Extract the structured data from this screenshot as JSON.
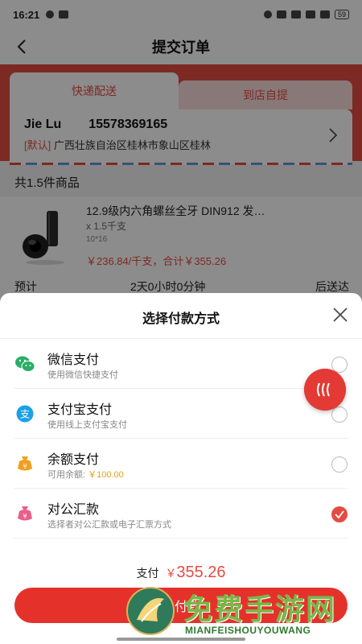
{
  "status_bar": {
    "time": "16:21",
    "battery": "59"
  },
  "nav": {
    "title": "提交订单"
  },
  "delivery": {
    "tab_express": "快递配送",
    "tab_pickup": "到店自提",
    "name": "Jie Lu",
    "phone": "15578369165",
    "default_tag": "[默认]",
    "address": "广西壮族自治区桂林市象山区桂林"
  },
  "goods": {
    "count_label": "共1.5件商品",
    "title": "12.9级内六角螺丝全牙 DIN912 发…",
    "qty": "x 1.5千支",
    "spec": "10*16",
    "price_line": "￥236.84/千支，合计￥355.26"
  },
  "eta": {
    "label": "预计",
    "value": "2天0小时0分钟",
    "suffix": "后送达"
  },
  "payment_sheet": {
    "title": "选择付款方式",
    "options": [
      {
        "name": "微信支付",
        "desc": "使用微信快捷支付",
        "icon": "wechat-icon",
        "selected": false
      },
      {
        "name": "支付宝支付",
        "desc": "使用线上支付宝支付",
        "icon": "alipay-icon",
        "selected": false
      },
      {
        "name": "余额支付",
        "desc_prefix": "可用余额:",
        "desc_amount": "￥100.00",
        "icon": "wallet-icon",
        "selected": false
      },
      {
        "name": "对公汇款",
        "desc": "选择者对公汇款或电子汇票方式",
        "icon": "bank-transfer-icon",
        "selected": true
      }
    ],
    "total_label": "支付",
    "currency": "￥",
    "total_amount": "355.26",
    "pay_button": "去付款"
  },
  "watermark": {
    "title": "免费手游网",
    "subtitle": "MIANFEISHOUYOUWANG"
  },
  "colors": {
    "accent": "#e44c43",
    "button": "#e4322b",
    "amount_gold": "#e0a11b",
    "wechat": "#2aae67",
    "alipay": "#1aa0e8"
  }
}
